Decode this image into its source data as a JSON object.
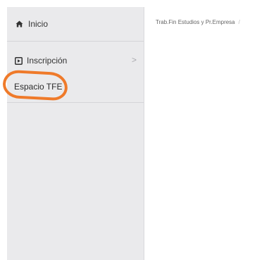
{
  "sidebar": {
    "items": [
      {
        "label": "Inicio",
        "icon": "home-icon"
      },
      {
        "label": "Inscripción",
        "icon": "play-square-icon",
        "chevron": ">"
      },
      {
        "label": "Espacio TFE"
      }
    ]
  },
  "breadcrumb": {
    "items": [
      "Trab.Fin Estudios y Pr.Empresa"
    ],
    "separator": "/"
  },
  "colors": {
    "sidebar_bg": "#eaeaec",
    "annotation": "#ef7a2a"
  }
}
